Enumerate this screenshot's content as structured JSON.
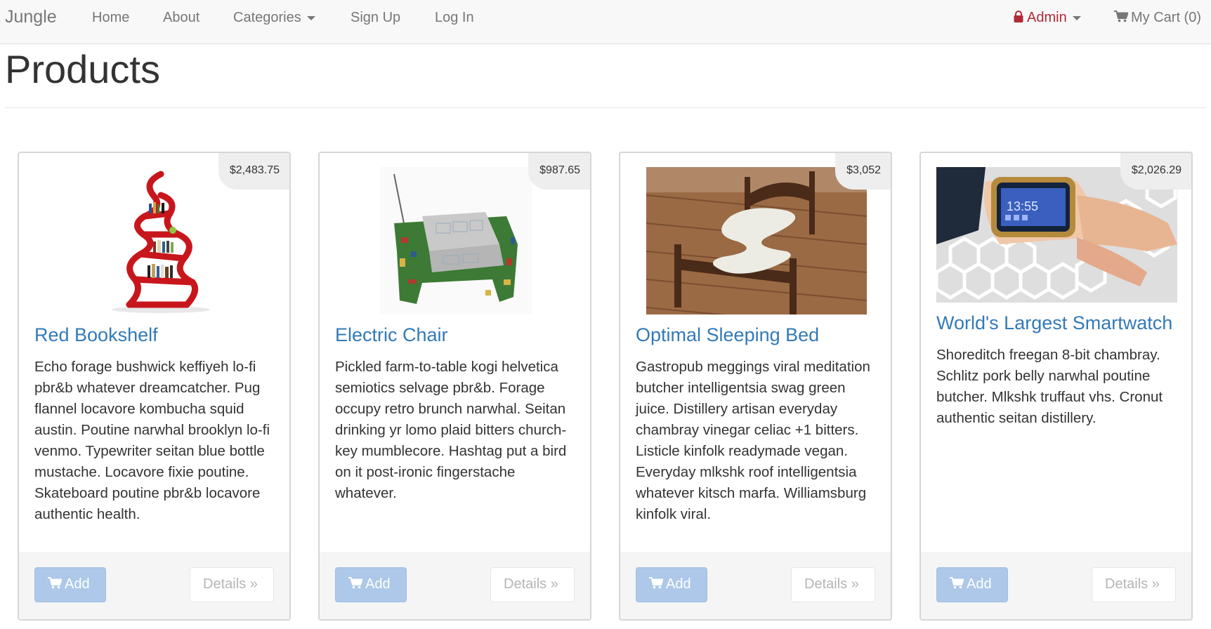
{
  "navbar": {
    "brand": "Jungle",
    "links": {
      "home": "Home",
      "about": "About",
      "categories": "Categories",
      "signup": "Sign Up",
      "login": "Log In"
    },
    "admin": "Admin",
    "cart": "My Cart (0)",
    "accent_admin": "#b02a37"
  },
  "page": {
    "title": "Products"
  },
  "buttons": {
    "add": "Add",
    "details": "Details »"
  },
  "products": [
    {
      "name": "Red Bookshelf",
      "price": "$2,483.75",
      "image": "red-bookshelf-image",
      "description": "Echo forage bushwick keffiyeh lo-fi pbr&b whatever dreamcatcher. Pug flannel locavore kombucha squid austin. Poutine narwhal brooklyn lo-fi venmo. Typewriter seitan blue bottle mustache. Locavore fixie poutine. Skateboard poutine pbr&b locavore authentic health."
    },
    {
      "name": "Electric Chair",
      "price": "$987.65",
      "image": "electric-chair-image",
      "description": "Pickled farm-to-table kogi helvetica semiotics selvage pbr&b. Forage occupy retro brunch narwhal. Seitan drinking yr lomo plaid bitters church-key mumblecore. Hashtag put a bird on it post-ironic fingerstache whatever."
    },
    {
      "name": "Optimal Sleeping Bed",
      "price": "$3,052",
      "image": "sleeping-bed-image",
      "description": "Gastropub meggings viral meditation butcher intelligentsia swag green juice. Distillery artisan everyday chambray vinegar celiac +1 bitters. Listicle kinfolk readymade vegan. Everyday mlkshk roof intelligentsia whatever kitsch marfa. Williamsburg kinfolk viral."
    },
    {
      "name": "World's Largest Smartwatch",
      "price": "$2,026.29",
      "image": "smartwatch-image",
      "watch_time": "13:55",
      "description": "Shoreditch freegan 8-bit chambray. Schlitz pork belly narwhal poutine butcher. Mlkshk truffaut vhs. Cronut authentic seitan distillery."
    }
  ]
}
